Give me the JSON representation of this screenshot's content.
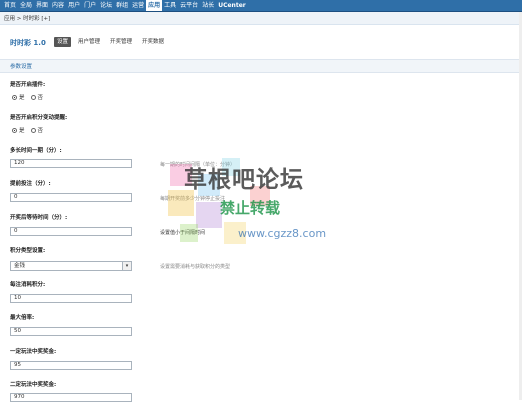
{
  "topnav": {
    "items": [
      "首页",
      "全局",
      "界面",
      "内容",
      "用户",
      "门户",
      "论坛",
      "群组",
      "运营",
      "应用",
      "工具",
      "云平台",
      "站长"
    ],
    "active_index": 9,
    "brand": "UCenter"
  },
  "breadcrumb": "应用 > 时时彩 [+]",
  "header": {
    "title": "时时彩 1.0",
    "tabs": [
      "设置",
      "用户管理",
      "开奖管理",
      "开奖数据"
    ],
    "active_tab": 0
  },
  "section_title": "参数设置",
  "fields": {
    "plugin_enabled": {
      "label": "是否开启插件:",
      "yes": "是",
      "no": "否",
      "selected": "yes"
    },
    "auto_credit": {
      "label": "是否开启积分变动提醒:",
      "yes": "是",
      "no": "否",
      "selected": "yes"
    },
    "interval": {
      "label": "多长时间一期（分）:",
      "value": "120",
      "tip": "每一期的时间间隔（单位：分钟）"
    },
    "late_stop": {
      "label": "提前投注（分）:",
      "value": "0",
      "tip": "每期开奖前多少分钟停止投注"
    },
    "wait_time": {
      "label": "开奖后等待时间（分）:",
      "value": "0",
      "tip": "设置值小于间隔时间"
    },
    "credit_type": {
      "label": "积分类型设置:",
      "value": "金钱",
      "tip": "设置需要消耗与获取积分的类型"
    },
    "cost_per": {
      "label": "每注消耗积分:",
      "value": "10"
    },
    "max_multiple": {
      "label": "最大倍率:",
      "value": "50"
    },
    "prize1": {
      "label": "一定玩法中奖奖金:",
      "value": "95"
    },
    "prize2": {
      "label": "二定玩法中奖奖金:",
      "value": "970"
    }
  },
  "watermark": {
    "line1": "草根吧论坛",
    "line2": "禁止转载",
    "line3": "www.cgzz8.com"
  }
}
